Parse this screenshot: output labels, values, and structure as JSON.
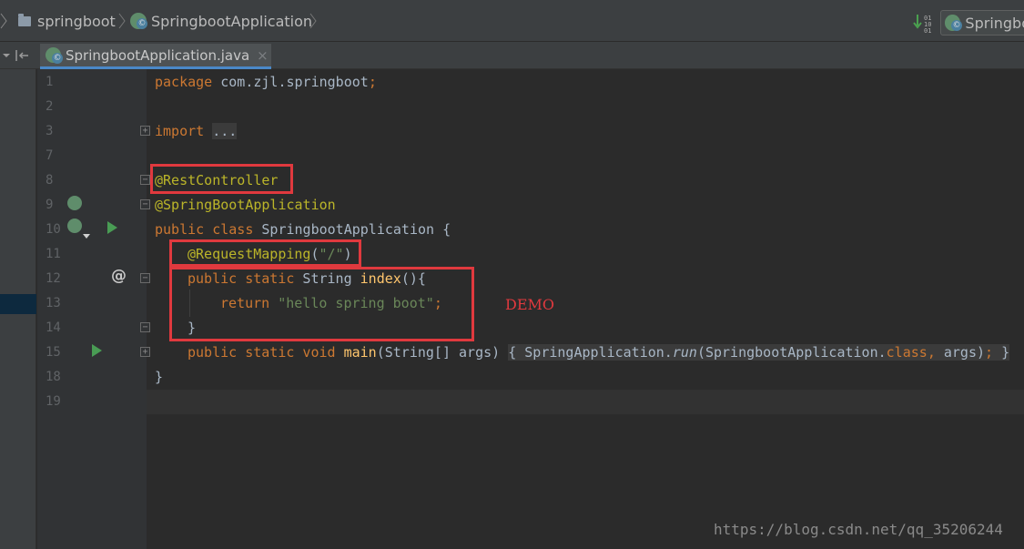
{
  "breadcrumbs": [
    "springboot",
    "SpringbootApplication"
  ],
  "run_config": "Springbo",
  "tab": {
    "label": "SpringbootApplication.java",
    "close": "×"
  },
  "line_numbers": [
    "1",
    "2",
    "3",
    "7",
    "8",
    "9",
    "10",
    "11",
    "12",
    "13",
    "14",
    "15",
    "18",
    "19"
  ],
  "code": {
    "l1_kw": "package",
    "l1_rest": " com.zjl.springboot",
    "l1_semi": ";",
    "l3_kw": "import",
    "l3_fold": "...",
    "l8": "@RestController",
    "l9": "@SpringBootApplication",
    "l10_kw": "public class",
    "l10_rest": " SpringbootApplication {",
    "l11_ann": "@RequestMapping",
    "l11_open": "(",
    "l11_str": "\"/\"",
    "l11_close": ")",
    "l12_kw": "public static",
    "l12_type": " String ",
    "l12_name": "index",
    "l12_rest": "(){",
    "l13_kw": "return",
    "l13_str": "\"hello spring boot\"",
    "l13_semi": ";",
    "l14": "}",
    "l15_kw": "public static void",
    "l15_name": "main",
    "l15_args": "(String[] args)",
    "l15_open": "{",
    "l15_body1": " SpringApplication.",
    "l15_run": "run",
    "l15_body2": "(SpringbootApplication.",
    "l15_class": "class",
    "l15_comma": ", ",
    "l15_args2": "args)",
    "l15_semi": ";",
    "l15_close": "}",
    "l18": "}"
  },
  "annotation_note": "DEMO",
  "watermark": "https://blog.csdn.net/qq_35206244",
  "gutter_at": "@",
  "colors": {
    "keyword": "#cc7832",
    "annotation": "#bbb529",
    "string": "#6a8759",
    "method": "#ffc66d",
    "highlight": "#e0393e",
    "text": "#a9b7c6"
  },
  "icons": [
    "folder-icon",
    "spring-boot-icon",
    "sort-icon",
    "run-icon",
    "bean-icon",
    "fold-icon"
  ]
}
